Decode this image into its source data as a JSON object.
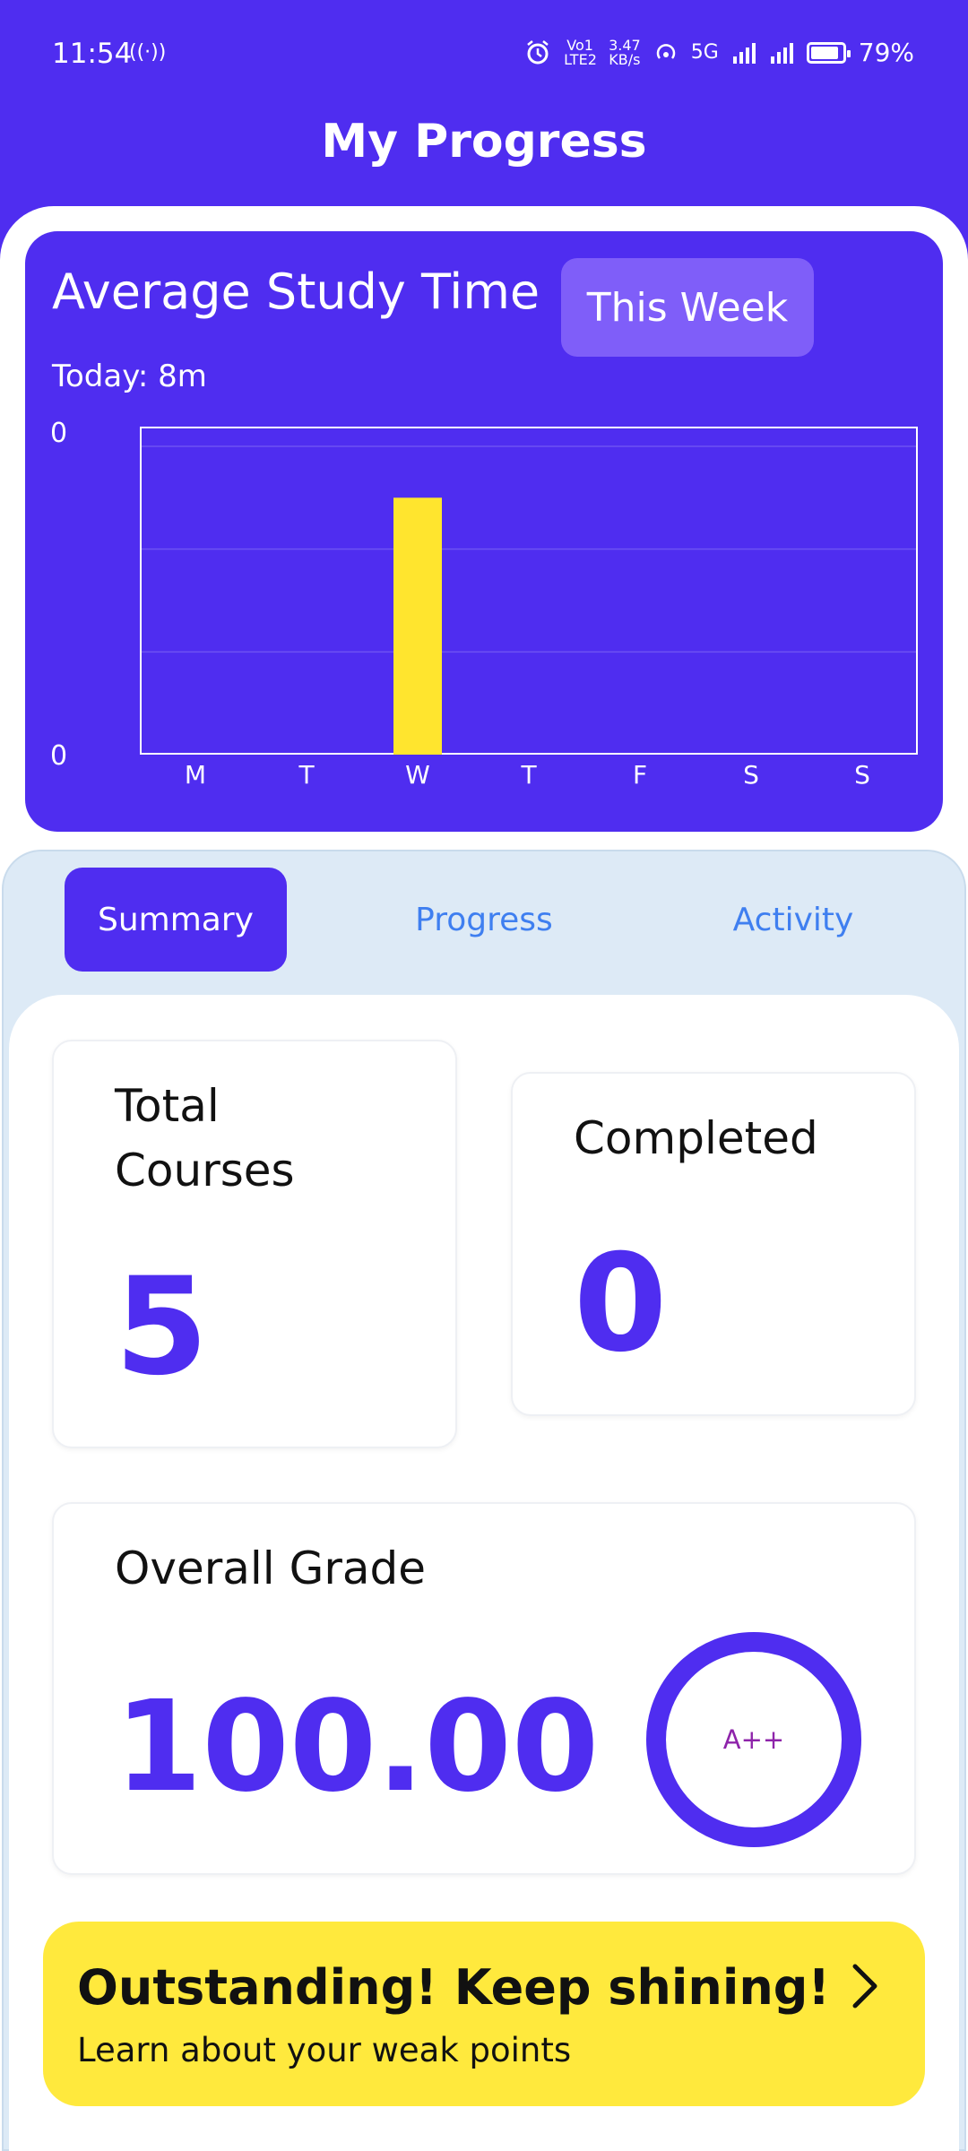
{
  "status_bar": {
    "time": "11:54",
    "hotspot_icon": "((·))",
    "net_left": "Vo1 LTE2",
    "speed_value": "3.47",
    "speed_unit": "KB/s",
    "network": "5G",
    "battery": "79%"
  },
  "header": {
    "title": "My Progress"
  },
  "study_card": {
    "title": "Average Study Time",
    "range_button": "This Week",
    "today": "Today: 8m",
    "y_top_label": "0",
    "y_bottom_label": "0"
  },
  "chart_data": {
    "type": "bar",
    "title": "Average Study Time",
    "categories": [
      "M",
      "T",
      "W",
      "T",
      "F",
      "S",
      "S"
    ],
    "values": [
      0,
      0,
      8,
      0,
      0,
      0,
      0
    ],
    "ylim": [
      0,
      9.6
    ],
    "grid": true,
    "bar_color": "#ffe52e"
  },
  "tabs": [
    {
      "label": "Summary",
      "active": true
    },
    {
      "label": "Progress",
      "active": false
    },
    {
      "label": "Activity",
      "active": false
    }
  ],
  "summary": {
    "total_courses_label": "Total Courses",
    "total_courses_value": "5",
    "completed_label": "Completed",
    "completed_value": "0",
    "overall_grade_label": "Overall Grade",
    "overall_grade_value": "100.00",
    "grade_badge": "A++",
    "grade_fraction": 1.0
  },
  "banner": {
    "title": "Outstanding! Keep shining!",
    "subtitle": "Learn about your weak points"
  },
  "colors": {
    "accent": "#4f2df0",
    "highlight": "#ffe93d",
    "tab_inactive": "#3f7ff0",
    "grade_text": "#8e24aa"
  }
}
